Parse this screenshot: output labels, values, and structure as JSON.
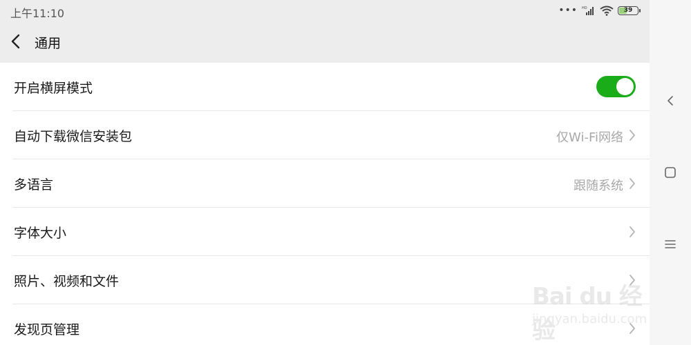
{
  "status_bar": {
    "time": "上午11:10",
    "battery_level": "39",
    "battery_fraction": 0.39,
    "network_type": "HD"
  },
  "header": {
    "title": "通用"
  },
  "settings": {
    "landscape": {
      "label": "开启横屏模式",
      "enabled": true
    },
    "auto_download": {
      "label": "自动下载微信安装包",
      "value": "仅Wi-Fi网络"
    },
    "language": {
      "label": "多语言",
      "value": "跟随系统"
    },
    "font_size": {
      "label": "字体大小"
    },
    "media_files": {
      "label": "照片、视频和文件"
    },
    "discover_manage": {
      "label": "发现页管理"
    }
  },
  "watermark": {
    "logo_text": "Bai du 经验",
    "url_text": "jingyan.baidu.com"
  },
  "colors": {
    "toggle_on": "#1aad19",
    "header_bg": "#ededed",
    "secondary_text": "#a8a8a8"
  },
  "icons": {
    "back": "chevron-left-icon",
    "row_arrow": "chevron-right-icon",
    "nav_back": "nav-back-icon",
    "nav_home": "nav-home-icon",
    "nav_menu": "nav-menu-icon"
  }
}
